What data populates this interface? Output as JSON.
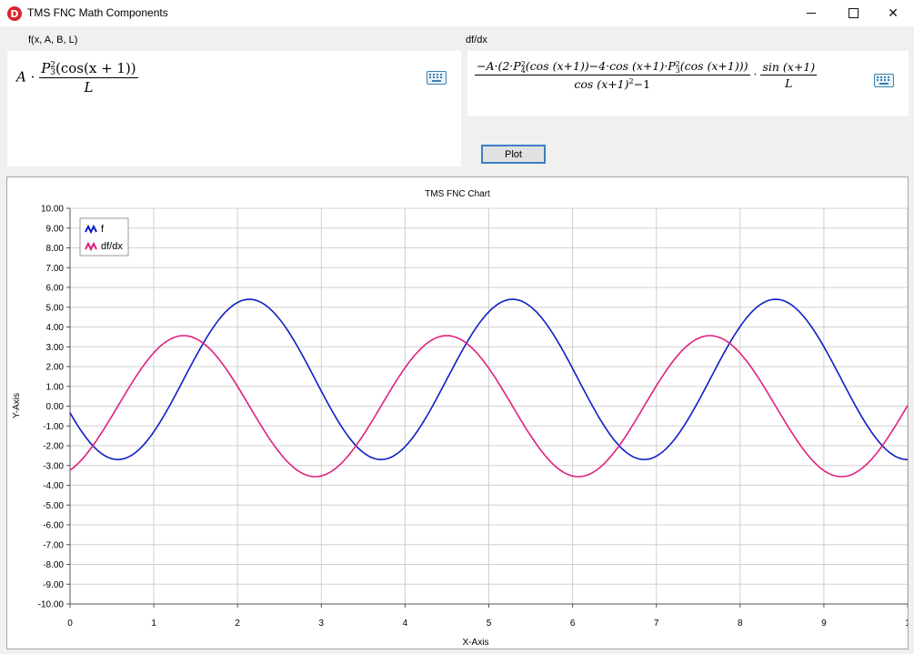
{
  "window": {
    "title": "TMS FNC Math Components",
    "icon_letter": "D"
  },
  "left_pane": {
    "label": "f(x, A, B, L)",
    "formula": {
      "A": "A",
      "dot": "·",
      "P": "P",
      "p_sup": "2",
      "p_sub": "3",
      "paren_cos": "(cos(x + 1))",
      "den": "L"
    }
  },
  "right_pane": {
    "label": "df/dx",
    "formula": {
      "num": "−A·(2·P",
      "num_a_sup": "2",
      "num_a_sub": "4",
      "num_b": "(cos (x+1))−4·cos (x+1)·P",
      "num_b_sup": "2",
      "num_b_sub": "3",
      "num_c": "(cos (x+1)))",
      "den": "cos (x+1)",
      "den_sup": "2",
      "den_tail": "−1",
      "mid": "·",
      "num2": "sin (x+1)",
      "den2": "L"
    }
  },
  "plot_button": {
    "label": "Plot"
  },
  "chart_data": {
    "type": "line",
    "title": "TMS FNC Chart",
    "xlabel": "X-Axis",
    "ylabel": "Y-Axis",
    "xlim": [
      0,
      10
    ],
    "ylim": [
      -10,
      10
    ],
    "x_ticks": [
      "0",
      "1",
      "2",
      "3",
      "4",
      "5",
      "6",
      "7",
      "8",
      "9",
      "1"
    ],
    "y_ticks": [
      "10.00",
      "9.00",
      "8.00",
      "7.00",
      "6.00",
      "5.00",
      "4.00",
      "3.00",
      "2.00",
      "1.00",
      "0.00",
      "-1.00",
      "-2.00",
      "-3.00",
      "-4.00",
      "-5.00",
      "-6.00",
      "-7.00",
      "-8.00",
      "-9.00",
      "-10.00"
    ],
    "grid": true,
    "legend_position": "top-left",
    "series": [
      {
        "name": "f",
        "color": "#0d1fc4"
      },
      {
        "name": "df/dx",
        "color": "#e0207f"
      }
    ]
  }
}
